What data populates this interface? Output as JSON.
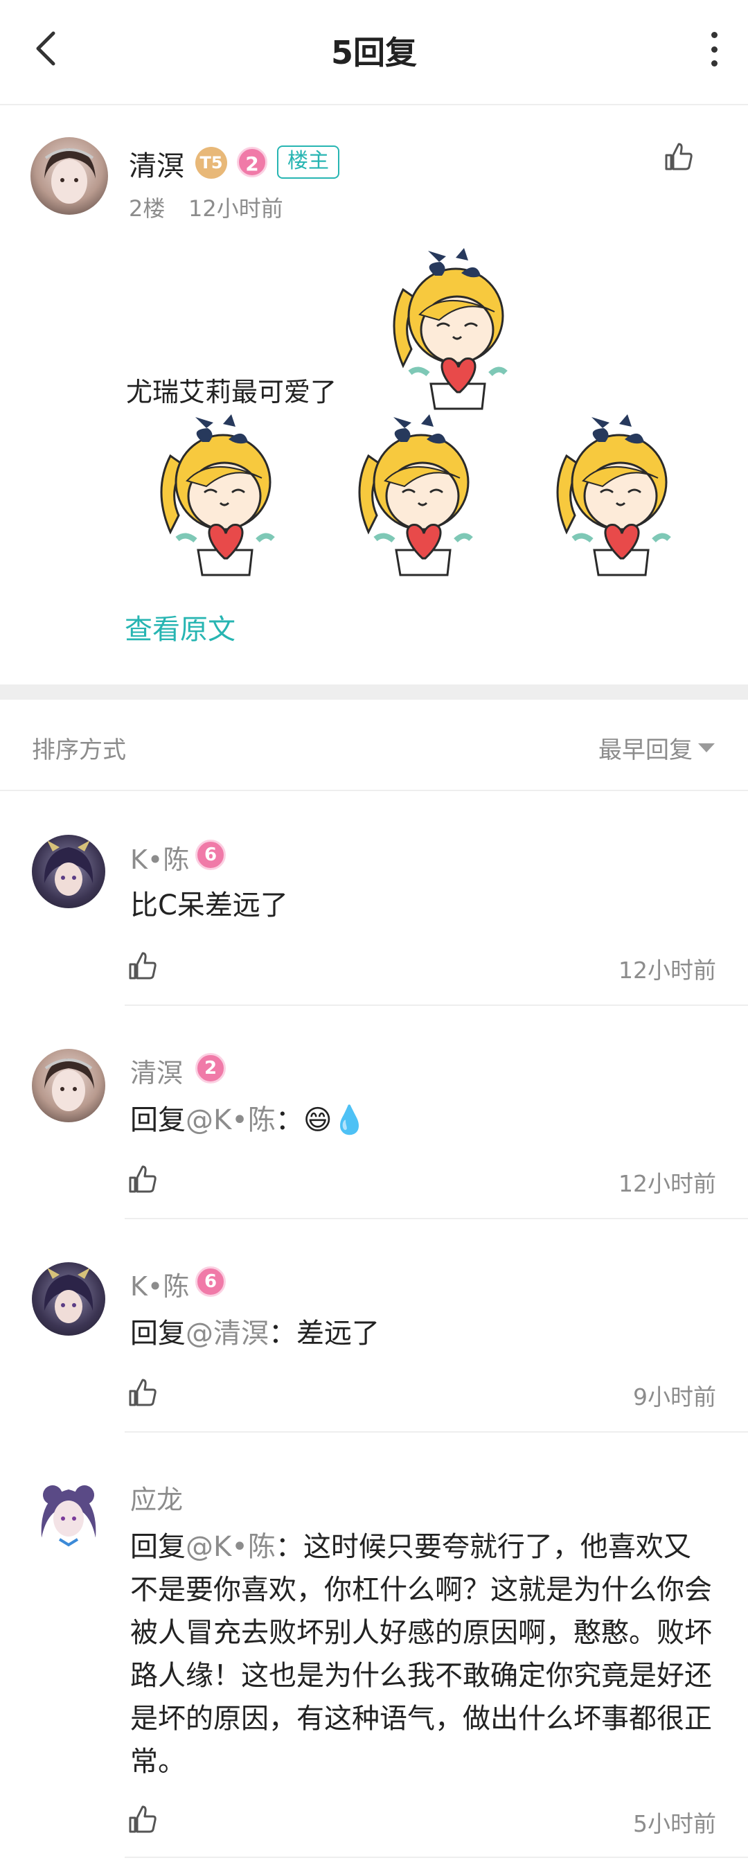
{
  "header": {
    "title": "5回复",
    "back_icon": "chevron-left-icon",
    "more_icon": "more-vertical-icon"
  },
  "post": {
    "author": "清溟",
    "level_badge": "T5",
    "rank_badge": "2",
    "owner_tag": "楼主",
    "floor": "2楼",
    "time": "12小时前",
    "text": "尤瑞艾莉最可爱了",
    "view_original": "查看原文",
    "sticker_icon": "chibi-girl-heart-sticker"
  },
  "sort": {
    "label": "排序方式",
    "value": "最早回复"
  },
  "replies": [
    {
      "author": "K•陈",
      "badge": "6",
      "prefix": "",
      "mention": "",
      "text": "比C呆差远了",
      "time": "12小时前"
    },
    {
      "author": "清溟",
      "badge": "2",
      "prefix": "回复",
      "mention": "@K•陈",
      "text": "：😄💧",
      "time": "12小时前"
    },
    {
      "author": "K•陈",
      "badge": "6",
      "prefix": "回复",
      "mention": "@清溟",
      "text": "：差远了",
      "time": "9小时前"
    },
    {
      "author": "应龙",
      "badge": "",
      "prefix": "回复",
      "mention": "@K•陈",
      "text": "：这时候只要夸就行了，他喜欢又不是要你喜欢，你杠什么啊？这就是为什么你会被人冒充去败坏别人好感的原因啊，憨憨。败坏路人缘！这也是为什么我不敢确定你究竟是好还是坏的原因，有这种语气，做出什么坏事都很正常。",
      "time": "5小时前"
    }
  ],
  "colors": {
    "accent": "#27b5b2",
    "badge_pink": "#f07aa8",
    "level_gold": "#e8b878",
    "muted_text": "#8c8c8c",
    "divider": "#eeeeee"
  }
}
